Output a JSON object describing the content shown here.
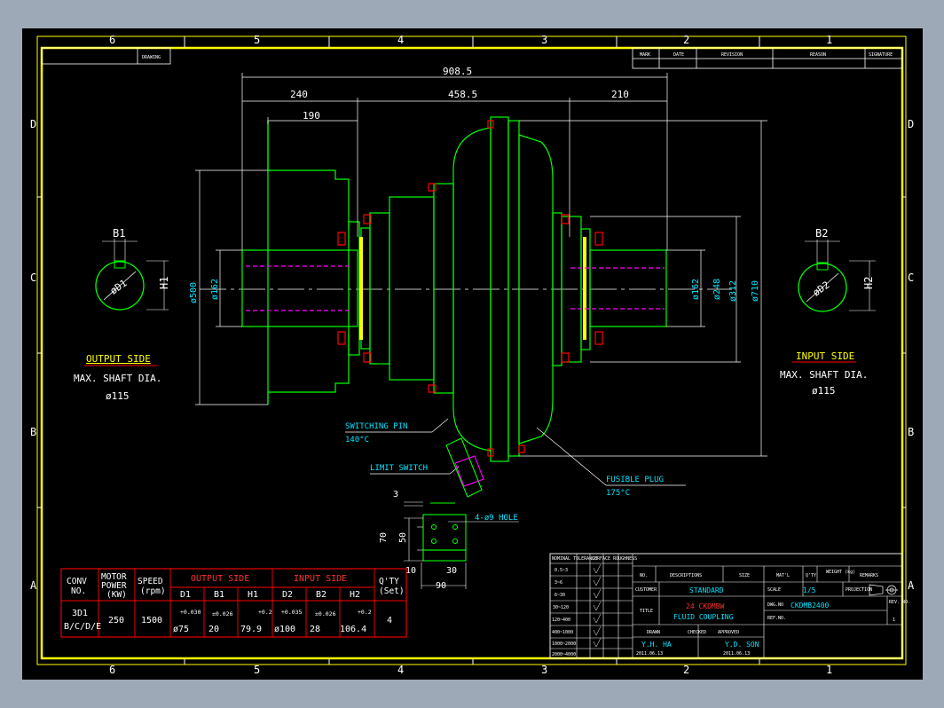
{
  "colors": {
    "background": "#000000",
    "frame": "#ffff00",
    "part": "#00ff00",
    "dim": "#ffffff",
    "dim_text": "#00e5ff",
    "note": "#ff0000",
    "centerline": "#ff00ff"
  },
  "border": {
    "columns": [
      "6",
      "5",
      "4",
      "3",
      "2",
      "1"
    ],
    "rows": [
      "D",
      "C",
      "B",
      "A"
    ]
  },
  "top_left_box": "DRAWING",
  "revision_header": {
    "mark": "MARK",
    "date": "DATE",
    "revision": "REVISION",
    "reason": "REASON",
    "signature": "SIGNATURE"
  },
  "dimensions": {
    "overall": "908.5",
    "left_len": "240",
    "middle_len": "458.5",
    "right_len": "210",
    "hub_len": "190",
    "d_left_outer": "ø500",
    "d_left_shaft": "ø162",
    "d_right_shaft": "ø162",
    "d_248": "ø248",
    "d_312": "ø312",
    "d_710": "ø710",
    "b1": "B1",
    "h1": "H1",
    "d1": "øD1",
    "b2": "B2",
    "h2": "H2",
    "d2": "øD2"
  },
  "notes": {
    "output_side": "OUTPUT SIDE",
    "output_max": "MAX. SHAFT DIA.",
    "output_dia": "ø115",
    "input_side": "INPUT SIDE",
    "input_max": "MAX. SHAFT DIA.",
    "input_dia": "ø115",
    "switching_pin": "SWITCHING PIN",
    "switching_temp": "140°C",
    "limit_switch": "LIMIT SWITCH",
    "fusible_plug": "FUSIBLE PLUG",
    "fusible_temp": "175°C",
    "hole": "4-ø9 HOLE",
    "d3": "3",
    "d70": "70",
    "d50": "50",
    "d10": "10",
    "d30": "30",
    "d90": "90"
  },
  "spec_table": {
    "headers": [
      "CONV\nNO.",
      "MOTOR\nPOWER\n(KW)",
      "SPEED\n(rpm)",
      "OUTPUT SIDE",
      "INPUT SIDE",
      "Q'TY\n(Set)"
    ],
    "sub_headers": [
      "D1",
      "B1",
      "H1",
      "D2",
      "B2",
      "H2"
    ],
    "row": {
      "conv": "3D1",
      "conv2": "B/C/D/E",
      "power": "250",
      "speed": "1500",
      "d1_tol": "+0.030",
      "d1": "ø75",
      "b1_tol": "±0.026",
      "b1": "20",
      "h1_tol": "+0.2",
      "h1": "79.9",
      "d2_tol": "+0.035",
      "d2": "ø100",
      "b2_tol": "±0.026",
      "b2": "28",
      "h2_tol": "+0.2",
      "h2": "106.4",
      "qty": "4"
    }
  },
  "title_block": {
    "no": "NO.",
    "description": "DESCRIPTIONS",
    "size": "SIZE",
    "matl": "MAT'L",
    "qty": "Q'TY",
    "weight": "WEIGHT\n(kg)",
    "remarks": "REMARKS",
    "customer_label": "CUSTOMER",
    "customer": "STANDARD",
    "scale_label": "SCALE",
    "scale": "1/5",
    "projection_label": "PROJECTION",
    "title_label": "TITLE",
    "title1": "24 CKDMBW",
    "title2": "FLUID COUPLING",
    "dwg_label": "DWG.NO",
    "dwg_no": "CKDMB2400",
    "ref_label": "REF.NO.",
    "rev_label": "REV.\nNO.",
    "rev": "1",
    "drawn_label": "DRAWN",
    "checked_label": "CHECKED",
    "approved_label": "APPROVED",
    "drawn_by": "Y.H. HA",
    "drawn_date": "2011.06.13",
    "approved_by": "Y.D. SON",
    "approved_date": "2011.06.13",
    "tol_header": [
      "NOMINAL TOLERANCE",
      "SURFACE ROUGHNESS"
    ],
    "tol_rows": [
      "0.5~3",
      "3~6",
      "6~30",
      "30~120",
      "120~400",
      "400~1000",
      "1000~2000",
      "2000~4000"
    ]
  }
}
